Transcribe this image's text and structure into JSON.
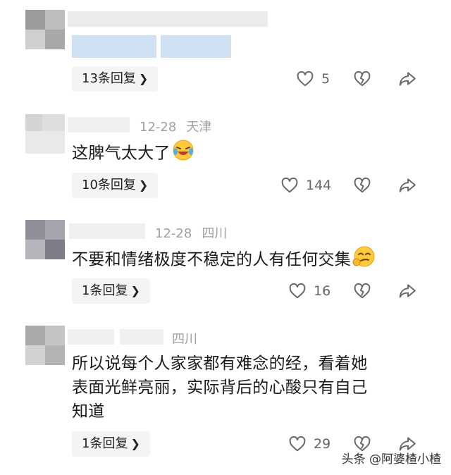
{
  "comments": [
    {
      "reply_label": "13条回复",
      "likes": "5"
    },
    {
      "date": "12-28",
      "location": "天津",
      "text": "这脾气太大了",
      "reply_label": "10条回复",
      "likes": "144"
    },
    {
      "date": "12-28",
      "location": "四川",
      "text": "不要和情绪极度不稳定的人有任何交集",
      "reply_label": "1条回复",
      "likes": "16"
    },
    {
      "location": "四川",
      "text_lines": [
        "所以说每个人家家都有难念的经，看着她",
        "表面光鲜亮丽，实际背后的心酸只有自己",
        "知道"
      ],
      "reply_label": "1条回复",
      "likes": "29"
    }
  ],
  "watermark": "头条 @阿婆楂小楂",
  "icons": {
    "like": "heart-outline-icon",
    "dislike": "broken-heart-icon",
    "share": "share-arrow-icon",
    "reply_chevron": "chevron-right-icon"
  },
  "colors": {
    "meta_text": "#a0a0a0",
    "reply_bg": "#f4f4f4",
    "blur_blue": "#cfe0f2"
  }
}
